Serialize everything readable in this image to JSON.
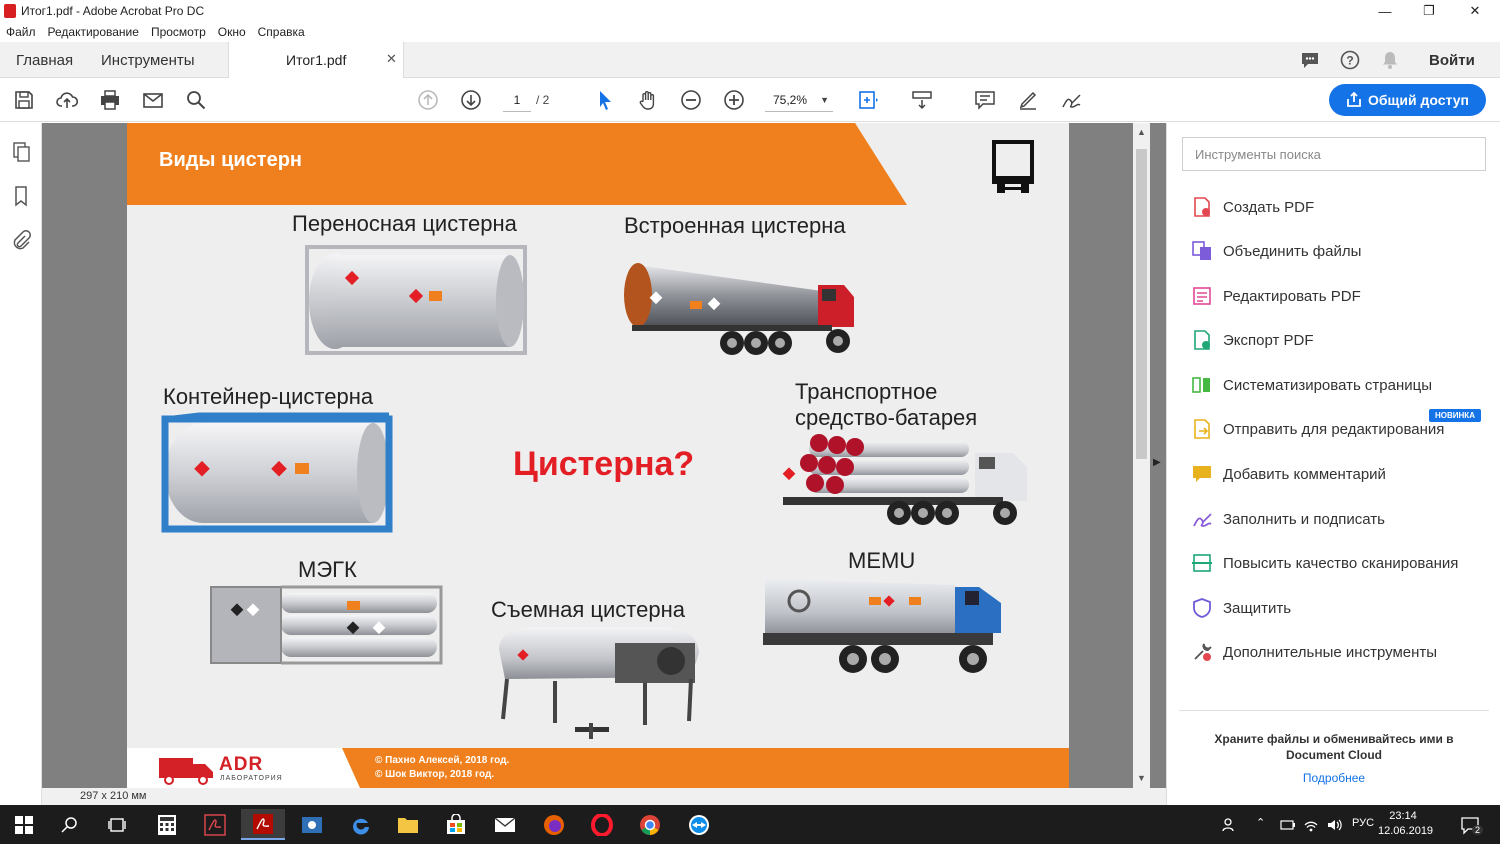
{
  "window": {
    "title": "Итог1.pdf - Adobe Acrobat Pro DC"
  },
  "menu": [
    "Файл",
    "Редактирование",
    "Просмотр",
    "Окно",
    "Справка"
  ],
  "tabs": {
    "home": "Главная",
    "tools": "Инструменты",
    "document": "Итог1.pdf",
    "signin": "Войти"
  },
  "toolbar": {
    "page_current": "1",
    "page_total": "/ 2",
    "zoom": "75,2%",
    "share": "Общий доступ"
  },
  "slide": {
    "header": "Виды цистерн",
    "center": "Цистерна?",
    "labels": {
      "portable": "Переносная цистерна",
      "builtin": "Встроенная цистерна",
      "container": "Контейнер-цистерна",
      "battery_l1": "Транспортное",
      "battery_l2": "средство-батарея",
      "megc": "МЭГК",
      "memu": "MEMU",
      "removable": "Съемная цистерна"
    },
    "footer": {
      "logo": "ADR",
      "logo_sub": "ЛАБОРАТОРИЯ",
      "copy1": "© Пахно Алексей, 2018 год.",
      "copy2": "© Шок Виктор, 2018 год."
    }
  },
  "status": {
    "page_size": "297 x 210 мм"
  },
  "rightpanel": {
    "search_placeholder": "Инструменты поиска",
    "items": [
      {
        "label": "Создать PDF",
        "icon": "create-pdf-icon",
        "color": "#e34850"
      },
      {
        "label": "Объединить файлы",
        "icon": "combine-files-icon",
        "color": "#7c5cd8"
      },
      {
        "label": "Редактировать PDF",
        "icon": "edit-pdf-icon",
        "color": "#e34896"
      },
      {
        "label": "Экспорт PDF",
        "icon": "export-pdf-icon",
        "color": "#1fa776"
      },
      {
        "label": "Систематизировать страницы",
        "icon": "organize-pages-icon",
        "color": "#46b844"
      },
      {
        "label": "Отправить для редактирования",
        "icon": "send-for-review-icon",
        "color": "#e8b21c"
      },
      {
        "label": "Добавить комментарий",
        "icon": "comment-icon",
        "color": "#e8b21c"
      },
      {
        "label": "Заполнить и подписать",
        "icon": "fill-sign-icon",
        "color": "#8a5cd8"
      },
      {
        "label": "Повысить качество сканирования",
        "icon": "enhance-scan-icon",
        "color": "#1fa776"
      },
      {
        "label": "Защитить",
        "icon": "protect-icon",
        "color": "#6f5cd8"
      },
      {
        "label": "Дополнительные инструменты",
        "icon": "more-tools-icon",
        "color": "#555555"
      }
    ],
    "badge": "НОВИНКА",
    "store_text": "Храните файлы и обменивайтесь ими в Document Cloud",
    "more_link": "Подробнее"
  },
  "taskbar": {
    "lang": "РУС",
    "time": "23:14",
    "date": "12.06.2019",
    "notif": "2"
  }
}
